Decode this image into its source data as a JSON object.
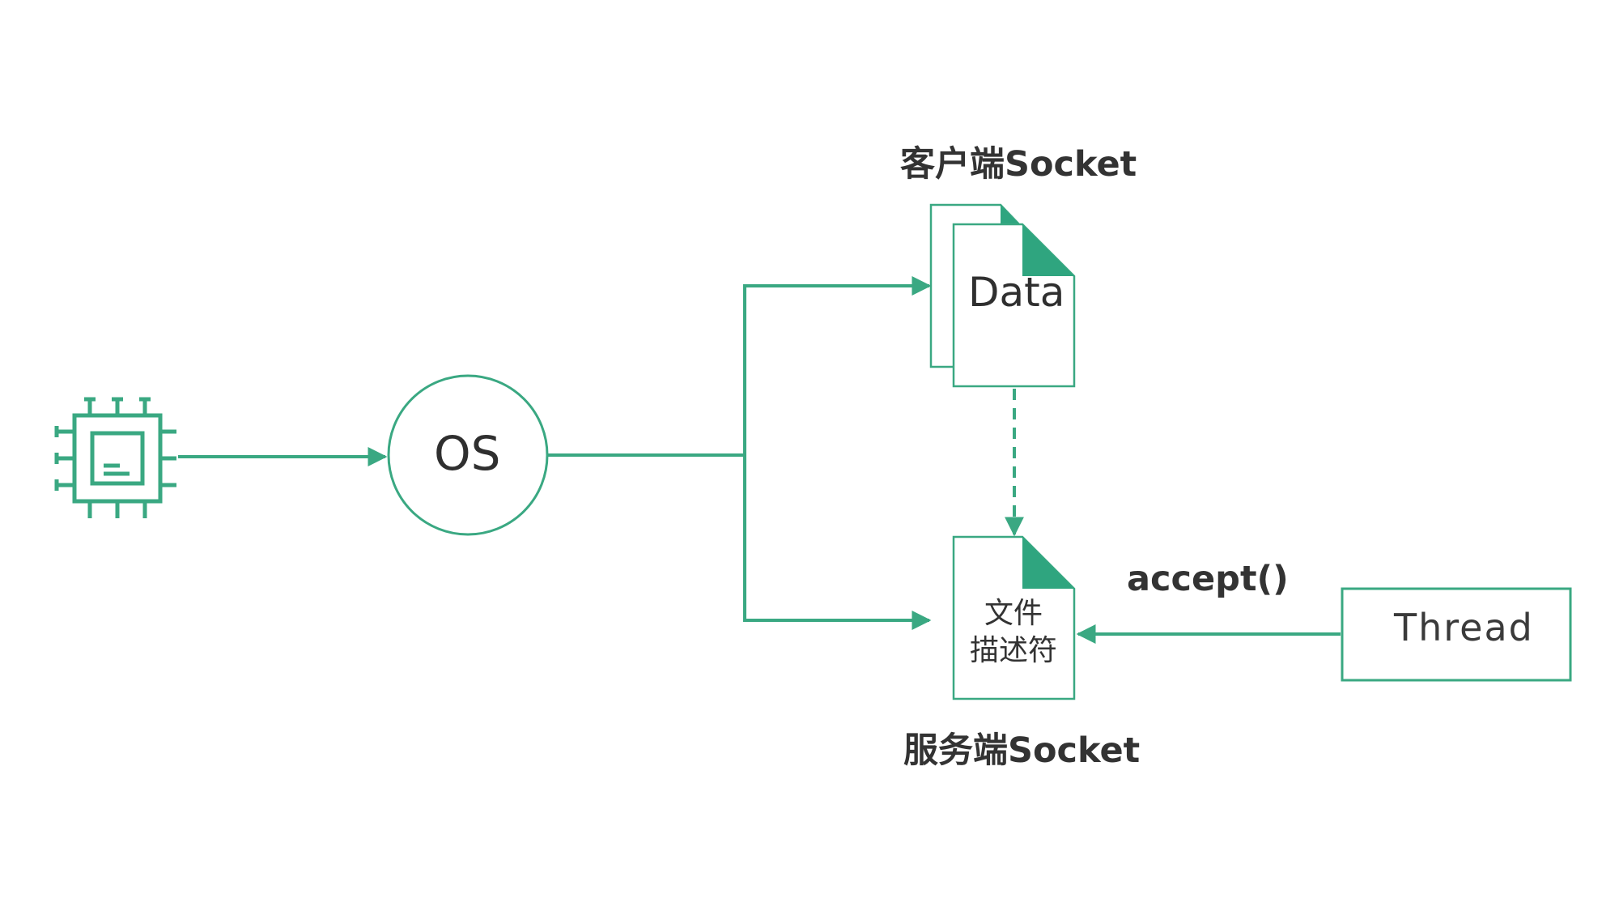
{
  "colors": {
    "accent": "#3aa882",
    "fold": "#2fa57f",
    "text": "#333333",
    "background": "#ffffff"
  },
  "icons": {
    "chip": "cpu-chip-icon"
  },
  "nodes": {
    "os": {
      "label": "OS"
    },
    "client_socket": {
      "title": "客户端Socket",
      "doc_label": "Data"
    },
    "server_socket": {
      "title": "服务端Socket",
      "doc_line1": "文件",
      "doc_line2": "描述符"
    },
    "thread": {
      "label": "Thread"
    }
  },
  "edges": {
    "thread_to_server": {
      "label": "accept()"
    }
  }
}
